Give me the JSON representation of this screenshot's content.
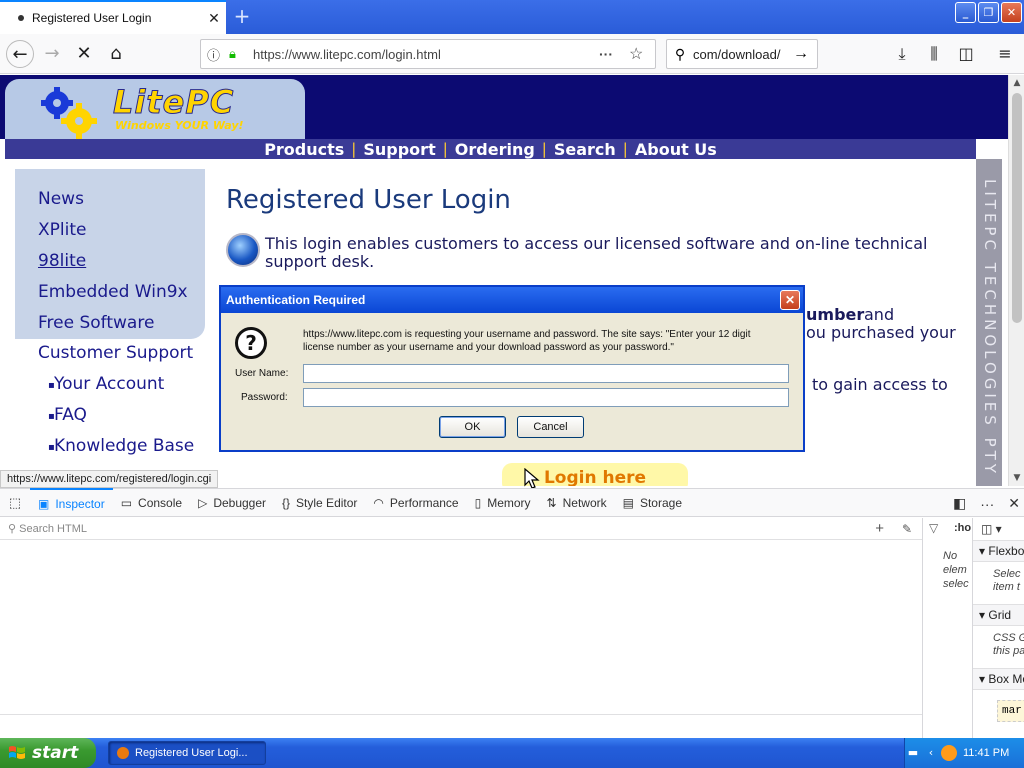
{
  "browser": {
    "tab_title": "Registered User Login",
    "tab_close": "✕",
    "new_tab": "+",
    "url": "https://www.litepc.com/login.html",
    "search_text": "com/download/",
    "status_url": "https://www.litepc.com/registered/login.cgi"
  },
  "site": {
    "logo": "LitePC",
    "tagline": "Windows YOUR Way!",
    "menu": [
      "Products",
      "Support",
      "Ordering",
      "Search",
      "About Us"
    ],
    "sidebar": [
      "News",
      "XPlite",
      "98lite",
      "Embedded Win9x",
      "Free Software",
      "Customer Support"
    ],
    "sidebar_sub": [
      "Your Account",
      "FAQ",
      "Knowledge Base"
    ],
    "heading": "Registered User Login",
    "intro": "This login enables customers to access our licensed software and on-line technical support desk.",
    "behind_1a": "umber",
    "behind_1b": "and",
    "behind_2": "ou purchased your",
    "behind_3": "to gain access to",
    "vertical_text": "LITEPC TECHNOLOGIES PTY LTD",
    "login_button": "Login here"
  },
  "dialog": {
    "title": "Authentication Required",
    "message": "https://www.litepc.com is requesting your username and password. The site says: \"Enter your 12 digit license number as your username and your download password as your password.\"",
    "username_label": "User Name:",
    "password_label": "Password:",
    "username_value": "",
    "password_value": "",
    "ok": "OK",
    "cancel": "Cancel"
  },
  "devtools": {
    "tabs": [
      "Inspector",
      "Console",
      "Debugger",
      "Style Editor",
      "Performance",
      "Memory",
      "Network",
      "Storage"
    ],
    "search_placeholder": "Search HTML",
    "hov": ":ho",
    "no_element": "No elem selec",
    "flexbox": "Flexbo",
    "flexbox_body_1": "Selec",
    "flexbox_body_2": "item t",
    "grid": "Grid",
    "grid_body_1": "CSS G",
    "grid_body_2": "this pa",
    "boxmodel": "Box Mo",
    "margin_label": "mar"
  },
  "taskbar": {
    "start": "start",
    "item": "Registered User Logi...",
    "clock": "11:41 PM"
  },
  "colors": {
    "banner": "#0c0a72",
    "menubar": "#3a3a96",
    "accent": "#0a84ff",
    "login_button": "#fff8a8"
  }
}
